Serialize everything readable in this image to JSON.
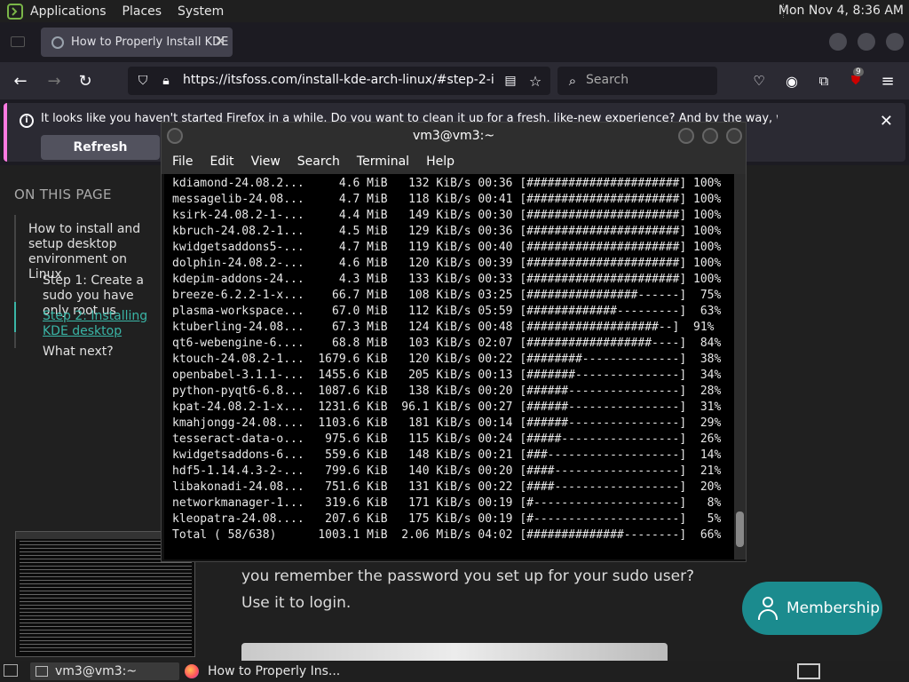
{
  "top_panel": {
    "menus": [
      "Applications",
      "Places",
      "System"
    ],
    "clock": "Mon Nov  4,  8:36 AM"
  },
  "browser": {
    "tab_title": "How to Properly Install KDE",
    "url": "https://itsfoss.com/install-kde-arch-linux/#step-2-install",
    "search_placeholder": "Search",
    "extension_badge": "9",
    "notification": {
      "message": "It looks like you haven't started Firefox in a while. Do you want to clean it up for a fresh, like-new experience? And by the way, welcome back!",
      "button": "Refresh Firefox..."
    }
  },
  "page": {
    "toc_heading": "ON THIS PAGE",
    "toc_items": [
      "How to install and setup desktop environment on Linux",
      "Step 1: Create a sudo you have only root us",
      "Step 2: Installing KDE desktop",
      "What next?"
    ],
    "body_text": "you remember the password you set up for your sudo user? Use it to login.",
    "membership_button": "Membership"
  },
  "terminal": {
    "title": "vm3@vm3:~",
    "menu": [
      "File",
      "Edit",
      "View",
      "Search",
      "Terminal",
      "Help"
    ],
    "lines": [
      "kdiamond-24.08.2...     4.6 MiB   132 KiB/s 00:36 [######################] 100%",
      "messagelib-24.08...     4.7 MiB   118 KiB/s 00:41 [######################] 100%",
      "ksirk-24.08.2-1-...     4.4 MiB   149 KiB/s 00:30 [######################] 100%",
      "kbruch-24.08.2-1...     4.5 MiB   129 KiB/s 00:36 [######################] 100%",
      "kwidgetsaddons5-...     4.7 MiB   119 KiB/s 00:40 [######################] 100%",
      "dolphin-24.08.2-...     4.6 MiB   120 KiB/s 00:39 [######################] 100%",
      "kdepim-addons-24...     4.3 MiB   133 KiB/s 00:33 [######################] 100%",
      "breeze-6.2.2-1-x...    66.7 MiB   108 KiB/s 03:25 [################------]  75%",
      "plasma-workspace...    67.0 MiB   112 KiB/s 05:59 [#############---------]  63%",
      "ktuberling-24.08...    67.3 MiB   124 KiB/s 00:48 [###################--]  91%",
      "qt6-webengine-6....    68.8 MiB   103 KiB/s 02:07 [##################----]  84%",
      "ktouch-24.08.2-1...  1679.6 KiB   120 KiB/s 00:22 [########--------------]  38%",
      "openbabel-3.1.1-...  1455.6 KiB   205 KiB/s 00:13 [#######---------------]  34%",
      "python-pyqt6-6.8...  1087.6 KiB   138 KiB/s 00:20 [######----------------]  28%",
      "kpat-24.08.2-1-x...  1231.6 KiB  96.1 KiB/s 00:27 [######----------------]  31%",
      "kmahjongg-24.08....  1103.6 KiB   181 KiB/s 00:14 [######----------------]  29%",
      "tesseract-data-o...   975.6 KiB   115 KiB/s 00:24 [#####-----------------]  26%",
      "kwidgetsaddons-6...   559.6 KiB   148 KiB/s 00:21 [###-------------------]  14%",
      "hdf5-1.14.4.3-2-...   799.6 KiB   140 KiB/s 00:20 [####------------------]  21%",
      "libakonadi-24.08...   751.6 KiB   131 KiB/s 00:22 [####------------------]  20%",
      "networkmanager-1...   319.6 KiB   171 KiB/s 00:19 [#---------------------]   8%",
      "kleopatra-24.08....   207.6 KiB   175 KiB/s 00:19 [#---------------------]   5%",
      "Total ( 58/638)      1003.1 MiB  2.06 MiB/s 04:02 [##############--------]  66%"
    ]
  },
  "taskbar": {
    "tasks": [
      "vm3@vm3:~",
      "How to Properly Ins..."
    ]
  }
}
